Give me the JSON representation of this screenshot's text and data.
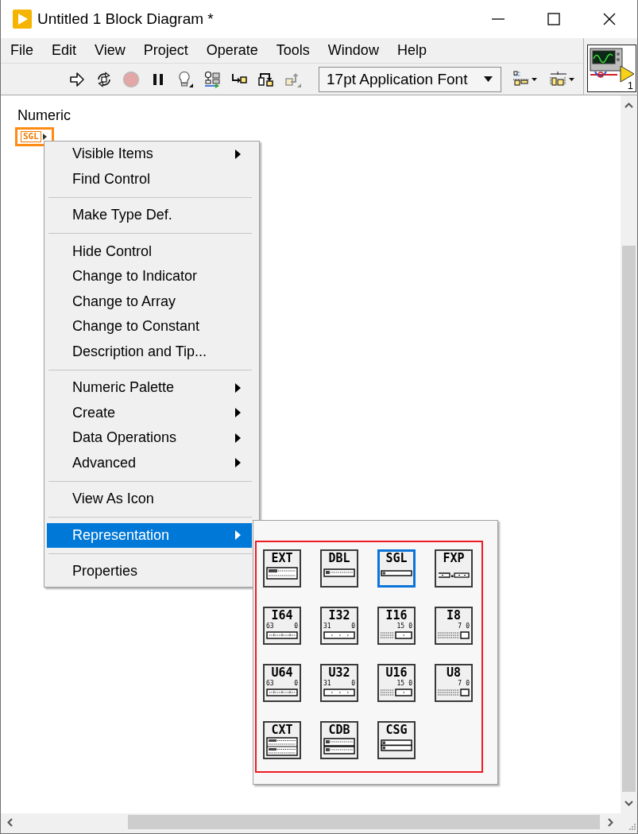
{
  "window": {
    "title": "Untitled 1 Block Diagram *"
  },
  "menu_bar": [
    "File",
    "Edit",
    "View",
    "Project",
    "Operate",
    "Tools",
    "Window",
    "Help"
  ],
  "toolbar": {
    "buttons": [
      {
        "kind": "run",
        "disabled": false
      },
      {
        "kind": "run_continuously",
        "disabled": false
      },
      {
        "kind": "abort",
        "disabled": true
      },
      {
        "kind": "pause",
        "disabled": false
      },
      {
        "kind": "highlight",
        "disabled": false
      },
      {
        "kind": "retain_wires",
        "disabled": false
      },
      {
        "kind": "step_into",
        "disabled": false
      },
      {
        "kind": "step_over",
        "disabled": false
      },
      {
        "kind": "step_out",
        "disabled": true
      }
    ],
    "font_dropdown": {
      "value": "17pt Application Font"
    },
    "tools": [
      {
        "kind": "align"
      },
      {
        "kind": "distribute"
      }
    ]
  },
  "vi_icon": {
    "caption": "1"
  },
  "diagram": {
    "terminal": {
      "label": "Numeric",
      "type": "SGL"
    }
  },
  "context_menu": {
    "items": [
      {
        "kind": "item",
        "label": "Visible Items",
        "submenu": true,
        "selected": false
      },
      {
        "kind": "item",
        "label": "Find Control",
        "submenu": false,
        "selected": false
      },
      {
        "kind": "separator"
      },
      {
        "kind": "item",
        "label": "Make Type Def.",
        "submenu": false,
        "selected": false
      },
      {
        "kind": "separator"
      },
      {
        "kind": "item",
        "label": "Hide Control",
        "submenu": false,
        "selected": false
      },
      {
        "kind": "item",
        "label": "Change to Indicator",
        "submenu": false,
        "selected": false
      },
      {
        "kind": "item",
        "label": "Change to Array",
        "submenu": false,
        "selected": false
      },
      {
        "kind": "item",
        "label": "Change to Constant",
        "submenu": false,
        "selected": false
      },
      {
        "kind": "item",
        "label": "Description and Tip...",
        "submenu": false,
        "selected": false
      },
      {
        "kind": "separator"
      },
      {
        "kind": "item",
        "label": "Numeric Palette",
        "submenu": true,
        "selected": false
      },
      {
        "kind": "item",
        "label": "Create",
        "submenu": true,
        "selected": false
      },
      {
        "kind": "item",
        "label": "Data Operations",
        "submenu": true,
        "selected": false
      },
      {
        "kind": "item",
        "label": "Advanced",
        "submenu": true,
        "selected": false
      },
      {
        "kind": "separator"
      },
      {
        "kind": "item",
        "label": "View As Icon",
        "submenu": false,
        "selected": false
      },
      {
        "kind": "separator"
      },
      {
        "kind": "item",
        "label": "Representation",
        "submenu": true,
        "selected": true
      },
      {
        "kind": "separator"
      },
      {
        "kind": "item",
        "label": "Properties",
        "submenu": false,
        "selected": false
      }
    ]
  },
  "representation_palette": {
    "outlined": true,
    "options": [
      {
        "label": "EXT",
        "kind": "extended",
        "selected": false
      },
      {
        "label": "DBL",
        "kind": "double",
        "selected": false
      },
      {
        "label": "SGL",
        "kind": "single",
        "selected": true
      },
      {
        "label": "FXP",
        "kind": "fixed",
        "selected": false
      },
      {
        "label": "I64",
        "kind": "int64",
        "bits": [
          "63",
          "0"
        ],
        "selected": false
      },
      {
        "label": "I32",
        "kind": "int32",
        "bits": [
          "31",
          "0"
        ],
        "selected": false
      },
      {
        "label": "I16",
        "kind": "int16",
        "bits": [
          "15",
          "0"
        ],
        "selected": false
      },
      {
        "label": "I8",
        "kind": "int8",
        "bits": [
          "7",
          "0"
        ],
        "selected": false
      },
      {
        "label": "U64",
        "kind": "int64",
        "bits": [
          "63",
          "0"
        ],
        "selected": false
      },
      {
        "label": "U32",
        "kind": "int32",
        "bits": [
          "31",
          "0"
        ],
        "selected": false
      },
      {
        "label": "U16",
        "kind": "int16",
        "bits": [
          "15",
          "0"
        ],
        "selected": false
      },
      {
        "label": "U8",
        "kind": "int8",
        "bits": [
          "7",
          "0"
        ],
        "selected": false
      },
      {
        "label": "CXT",
        "kind": "complex_extended",
        "selected": false
      },
      {
        "label": "CDB",
        "kind": "complex_double",
        "selected": false
      },
      {
        "label": "CSG",
        "kind": "complex_single",
        "selected": false
      }
    ]
  }
}
